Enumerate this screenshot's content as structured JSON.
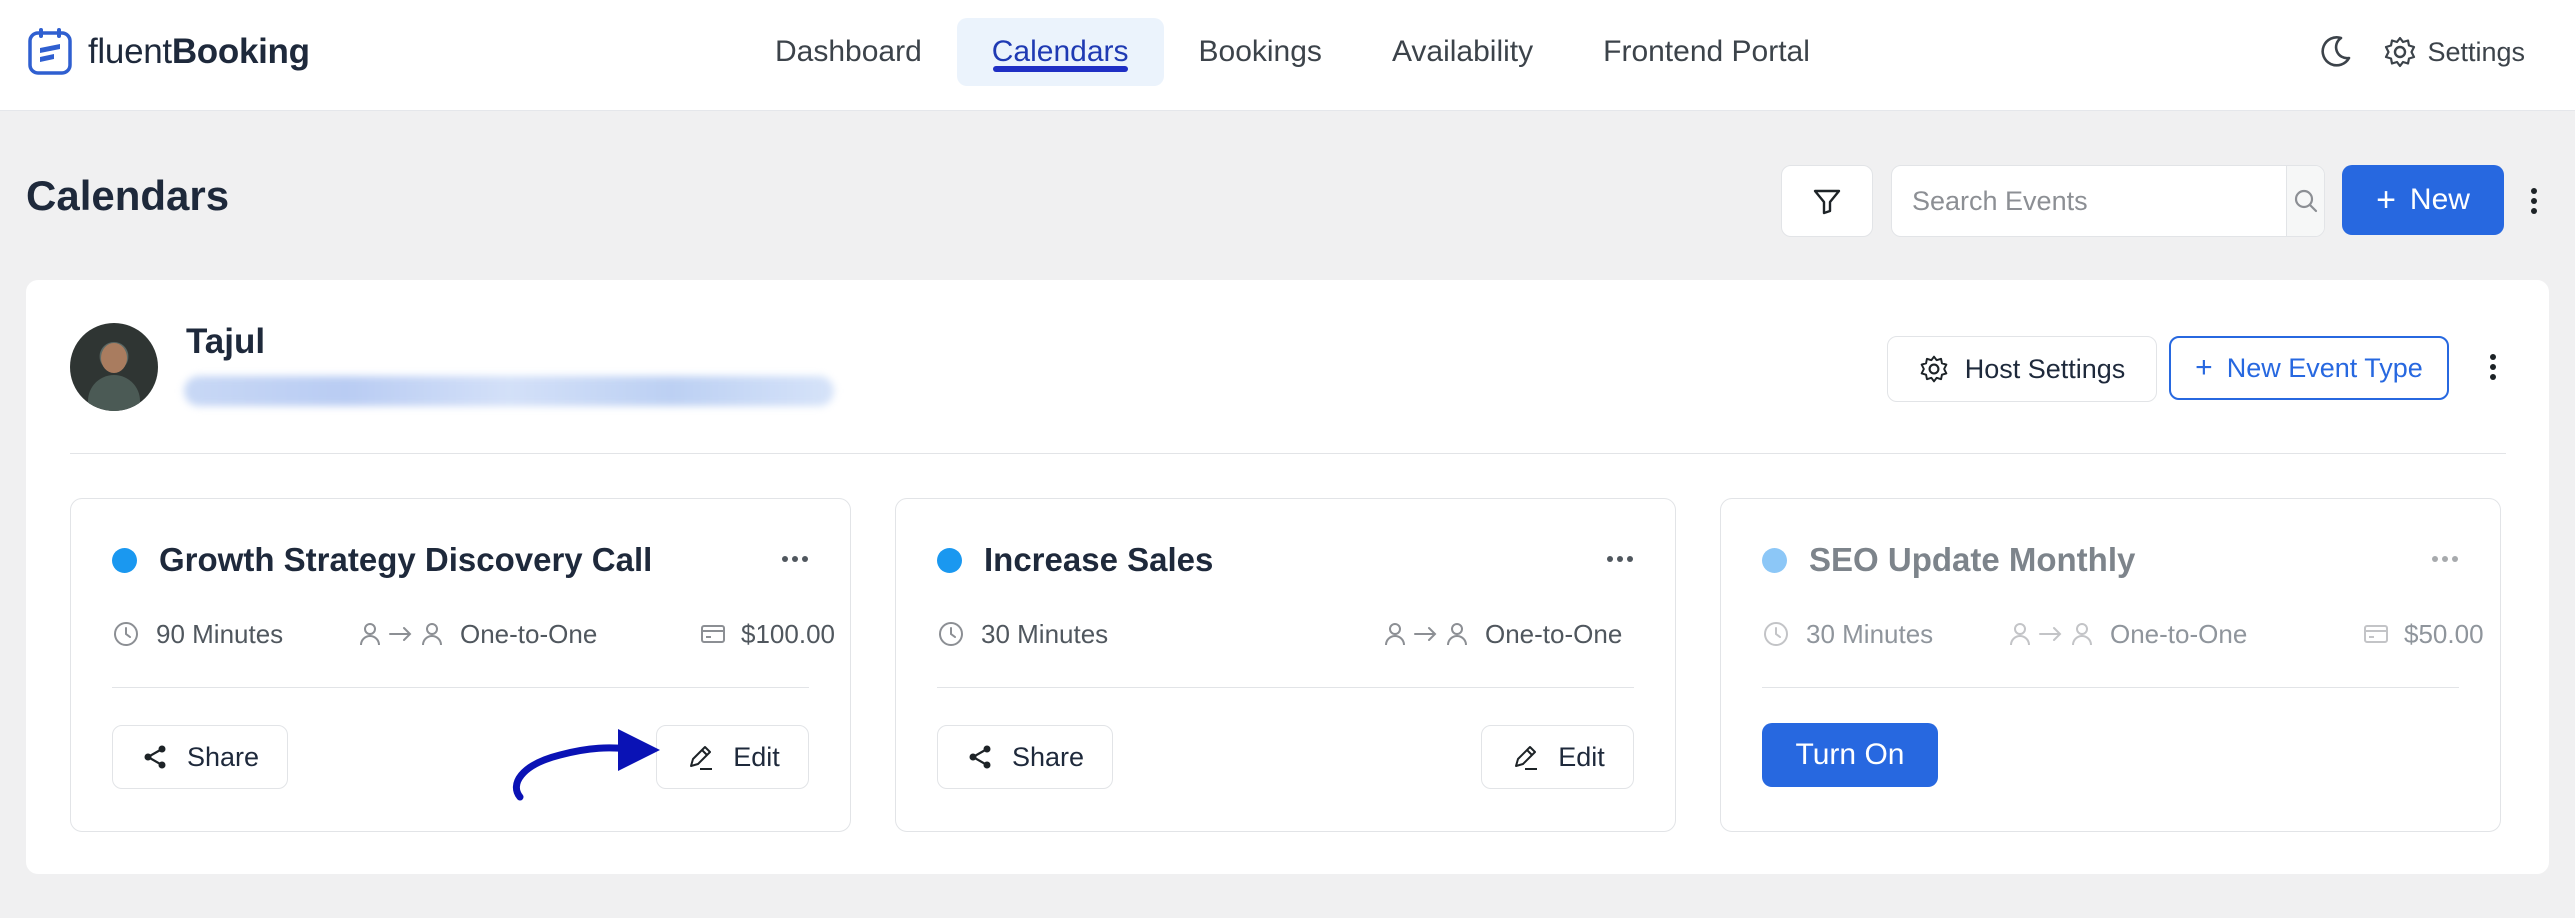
{
  "app": {
    "logo_light": "fluent",
    "logo_bold": "Booking"
  },
  "nav": {
    "items": [
      {
        "label": "Dashboard"
      },
      {
        "label": "Calendars",
        "active": true
      },
      {
        "label": "Bookings"
      },
      {
        "label": "Availability"
      },
      {
        "label": "Frontend Portal"
      }
    ],
    "settings_label": "Settings"
  },
  "page": {
    "title": "Calendars",
    "search_placeholder": "Search Events",
    "new_label": "New"
  },
  "host": {
    "name": "Tajul",
    "host_settings_label": "Host Settings",
    "new_event_type_label": "New Event Type"
  },
  "events": [
    {
      "title": "Growth Strategy Discovery Call",
      "dot_color": "#1a98f0",
      "duration": "90 Minutes",
      "type": "One-to-One",
      "price": "$100.00",
      "share_label": "Share",
      "edit_label": "Edit",
      "enabled": true
    },
    {
      "title": "Increase Sales",
      "dot_color": "#1a98f0",
      "duration": "30 Minutes",
      "type": "One-to-One",
      "price": "",
      "share_label": "Share",
      "edit_label": "Edit",
      "enabled": true
    },
    {
      "title": "SEO Update Monthly",
      "dot_color": "#8cc7f7",
      "duration": "30 Minutes",
      "type": "One-to-One",
      "price": "$50.00",
      "turn_on_label": "Turn On",
      "enabled": false
    }
  ],
  "colors": {
    "primary": "#2768e0",
    "nav_active_underline": "#1f2fc4",
    "annotation_arrow": "#0a12b5"
  },
  "icons": [
    "fluentbooking-logo-icon",
    "moon-icon",
    "gear-icon",
    "filter-icon",
    "search-icon",
    "more-vertical-icon",
    "clock-icon",
    "people-arrow-icon",
    "credit-card-icon",
    "share-icon",
    "pencil-icon",
    "more-horizontal-icon"
  ]
}
